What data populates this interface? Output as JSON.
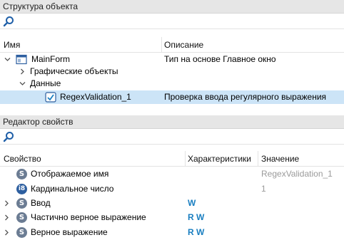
{
  "structure_panel": {
    "title": "Структура объекта",
    "columns": {
      "name": "Имя",
      "description": "Описание"
    },
    "rows": [
      {
        "name": "MainForm",
        "description": "Тип на основе Главное окно"
      },
      {
        "name": "Графические объекты",
        "description": ""
      },
      {
        "name": "Данные",
        "description": ""
      },
      {
        "name": "RegexValidation_1",
        "description": "Проверка ввода регулярного выражения"
      }
    ]
  },
  "property_panel": {
    "title": "Редактор свойств",
    "columns": {
      "property": "Свойство",
      "characteristics": "Характеристики",
      "value": "Значение"
    },
    "rows": [
      {
        "icon_label": "S",
        "name": "Отображаемое имя",
        "characteristics": "",
        "value": "RegexValidation_1"
      },
      {
        "icon_label": "i8",
        "name": "Кардинальное число",
        "characteristics": "",
        "value": "1"
      },
      {
        "icon_label": "S",
        "name": "Ввод",
        "characteristics": "W",
        "value": ""
      },
      {
        "icon_label": "S",
        "name": "Частично верное выражение",
        "characteristics": "R W",
        "value": ""
      },
      {
        "icon_label": "S",
        "name": "Верное выражение",
        "characteristics": "R W",
        "value": ""
      }
    ]
  },
  "colors": {
    "selection": "#cce4f7",
    "accent": "#1a7fc1",
    "panel_title_bg": "#e6e6e6"
  }
}
